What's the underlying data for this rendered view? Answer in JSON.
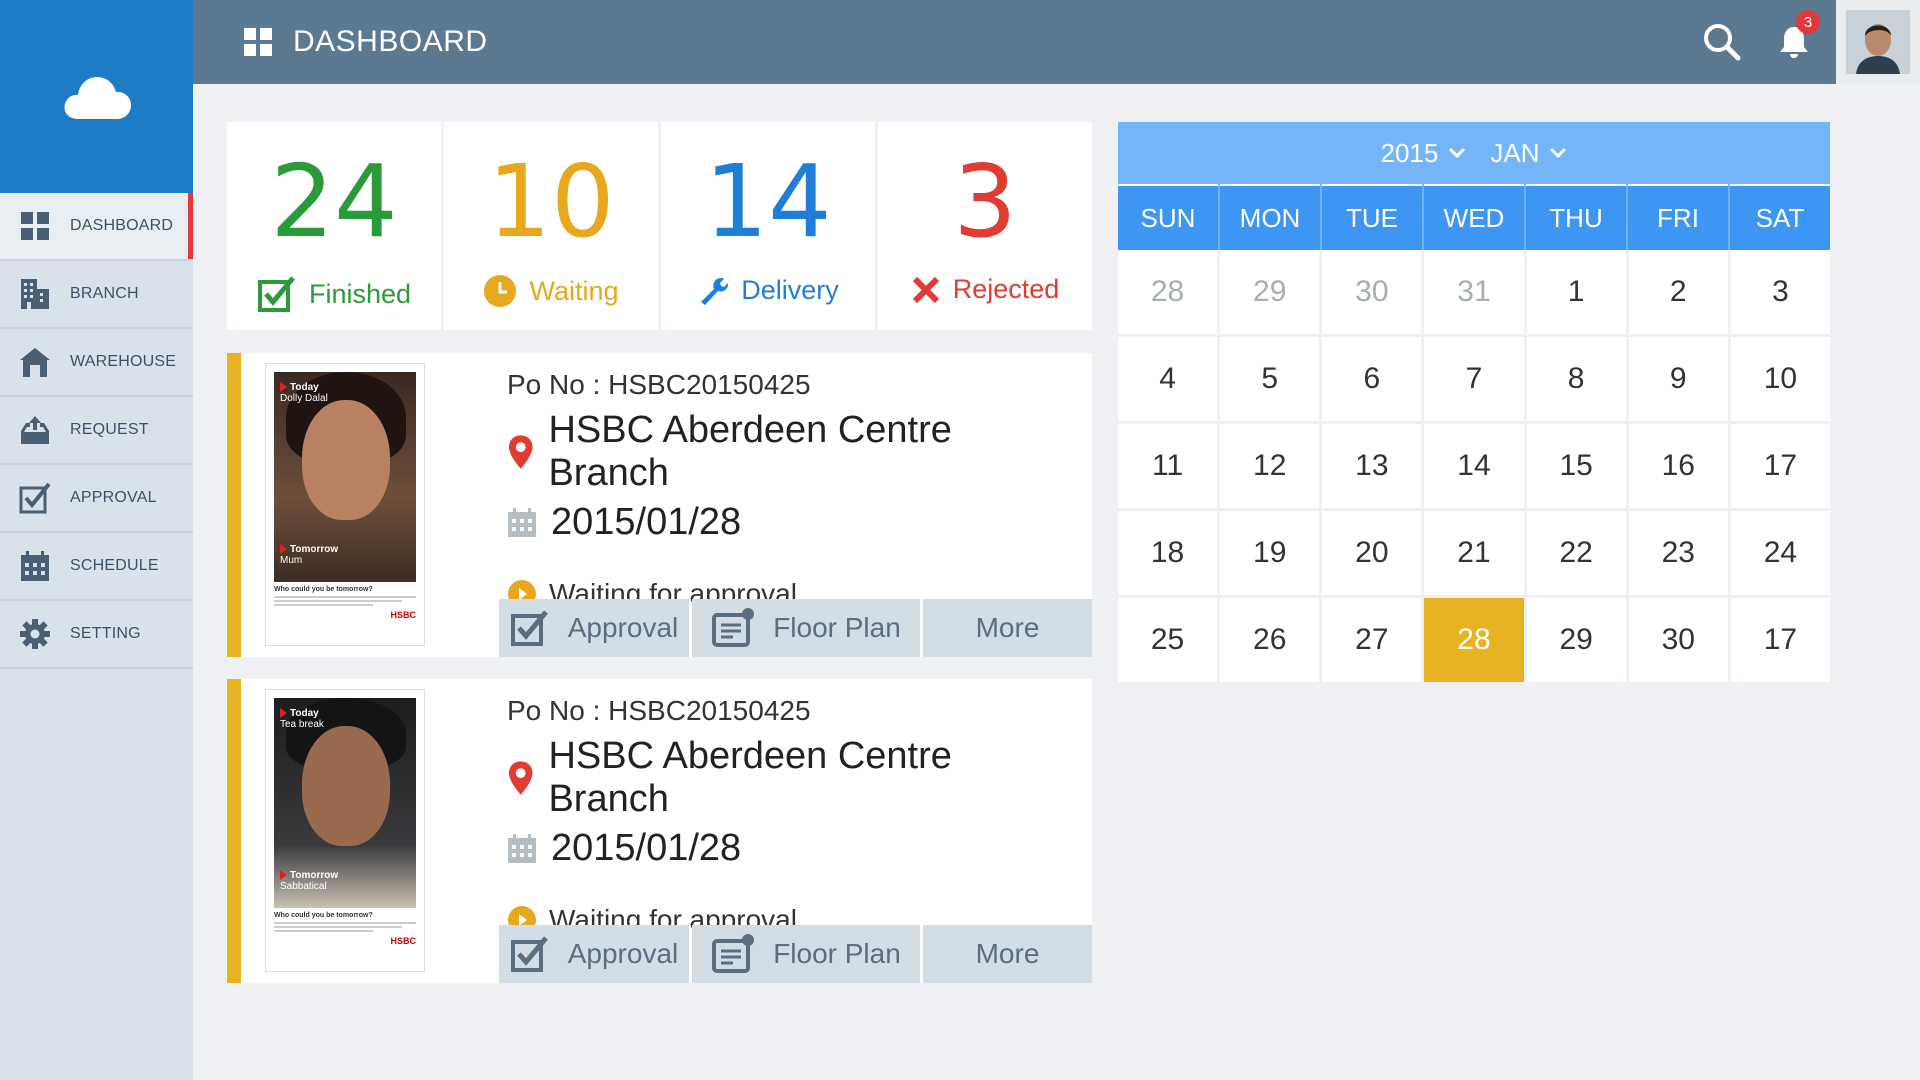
{
  "header": {
    "title": "DASHBOARD",
    "notifications": "3"
  },
  "sidebar": {
    "items": [
      {
        "label": "DASHBOARD",
        "icon": "grid-icon"
      },
      {
        "label": "BRANCH",
        "icon": "building-icon"
      },
      {
        "label": "WAREHOUSE",
        "icon": "warehouse-icon"
      },
      {
        "label": "REQUEST",
        "icon": "request-icon"
      },
      {
        "label": "APPROVAL",
        "icon": "checkbox-icon"
      },
      {
        "label": "SCHEDULE",
        "icon": "calendar-icon"
      },
      {
        "label": "SETTING",
        "icon": "gear-icon"
      }
    ]
  },
  "stats": [
    {
      "value": "24",
      "label": "Finished",
      "color": "#2a9a3b"
    },
    {
      "value": "10",
      "label": "Waiting",
      "color": "#e8a81e"
    },
    {
      "value": "14",
      "label": "Delivery",
      "color": "#1f7fd8"
    },
    {
      "value": "3",
      "label": "Rejected",
      "color": "#e03c31"
    }
  ],
  "orders": [
    {
      "po": "Po No : HSBC20150425",
      "branch": "HSBC Aberdeen Centre Branch",
      "date": "2015/01/28",
      "status": "Waiting for approval",
      "poster": {
        "today": "Today",
        "today_sub": "Dolly Dalal",
        "tomorrow": "Tomorrow",
        "tomorrow_sub": "Mum",
        "caption": "Who could you be tomorrow?",
        "logo": "HSBC"
      },
      "actions": {
        "approval": "Approval",
        "floorplan": "Floor Plan",
        "more": "More"
      }
    },
    {
      "po": "Po No : HSBC20150425",
      "branch": "HSBC Aberdeen Centre Branch",
      "date": "2015/01/28",
      "status": "Waiting for approval",
      "poster": {
        "today": "Today",
        "today_sub": "Tea break",
        "tomorrow": "Tomorrow",
        "tomorrow_sub": "Sabbatical",
        "caption": "Who could you be tomorrow?",
        "logo": "HSBC"
      },
      "actions": {
        "approval": "Approval",
        "floorplan": "Floor Plan",
        "more": "More"
      }
    }
  ],
  "calendar": {
    "year": "2015",
    "month": "JAN",
    "weekdays": [
      "SUN",
      "MON",
      "TUE",
      "WED",
      "THU",
      "FRI",
      "SAT"
    ],
    "cells": [
      [
        "28",
        "muted"
      ],
      [
        "29",
        "muted"
      ],
      [
        "30",
        "muted"
      ],
      [
        "31",
        "muted"
      ],
      [
        "1",
        ""
      ],
      [
        "2",
        ""
      ],
      [
        "3",
        ""
      ],
      [
        "4",
        ""
      ],
      [
        "5",
        ""
      ],
      [
        "6",
        ""
      ],
      [
        "7",
        ""
      ],
      [
        "8",
        ""
      ],
      [
        "9",
        ""
      ],
      [
        "10",
        ""
      ],
      [
        "11",
        ""
      ],
      [
        "12",
        ""
      ],
      [
        "13",
        ""
      ],
      [
        "14",
        ""
      ],
      [
        "15",
        ""
      ],
      [
        "16",
        ""
      ],
      [
        "17",
        ""
      ],
      [
        "18",
        ""
      ],
      [
        "19",
        ""
      ],
      [
        "20",
        ""
      ],
      [
        "21",
        ""
      ],
      [
        "22",
        ""
      ],
      [
        "23",
        ""
      ],
      [
        "24",
        ""
      ],
      [
        "25",
        ""
      ],
      [
        "26",
        ""
      ],
      [
        "27",
        ""
      ],
      [
        "28",
        "today"
      ],
      [
        "29",
        ""
      ],
      [
        "30",
        ""
      ],
      [
        "17",
        ""
      ]
    ]
  }
}
